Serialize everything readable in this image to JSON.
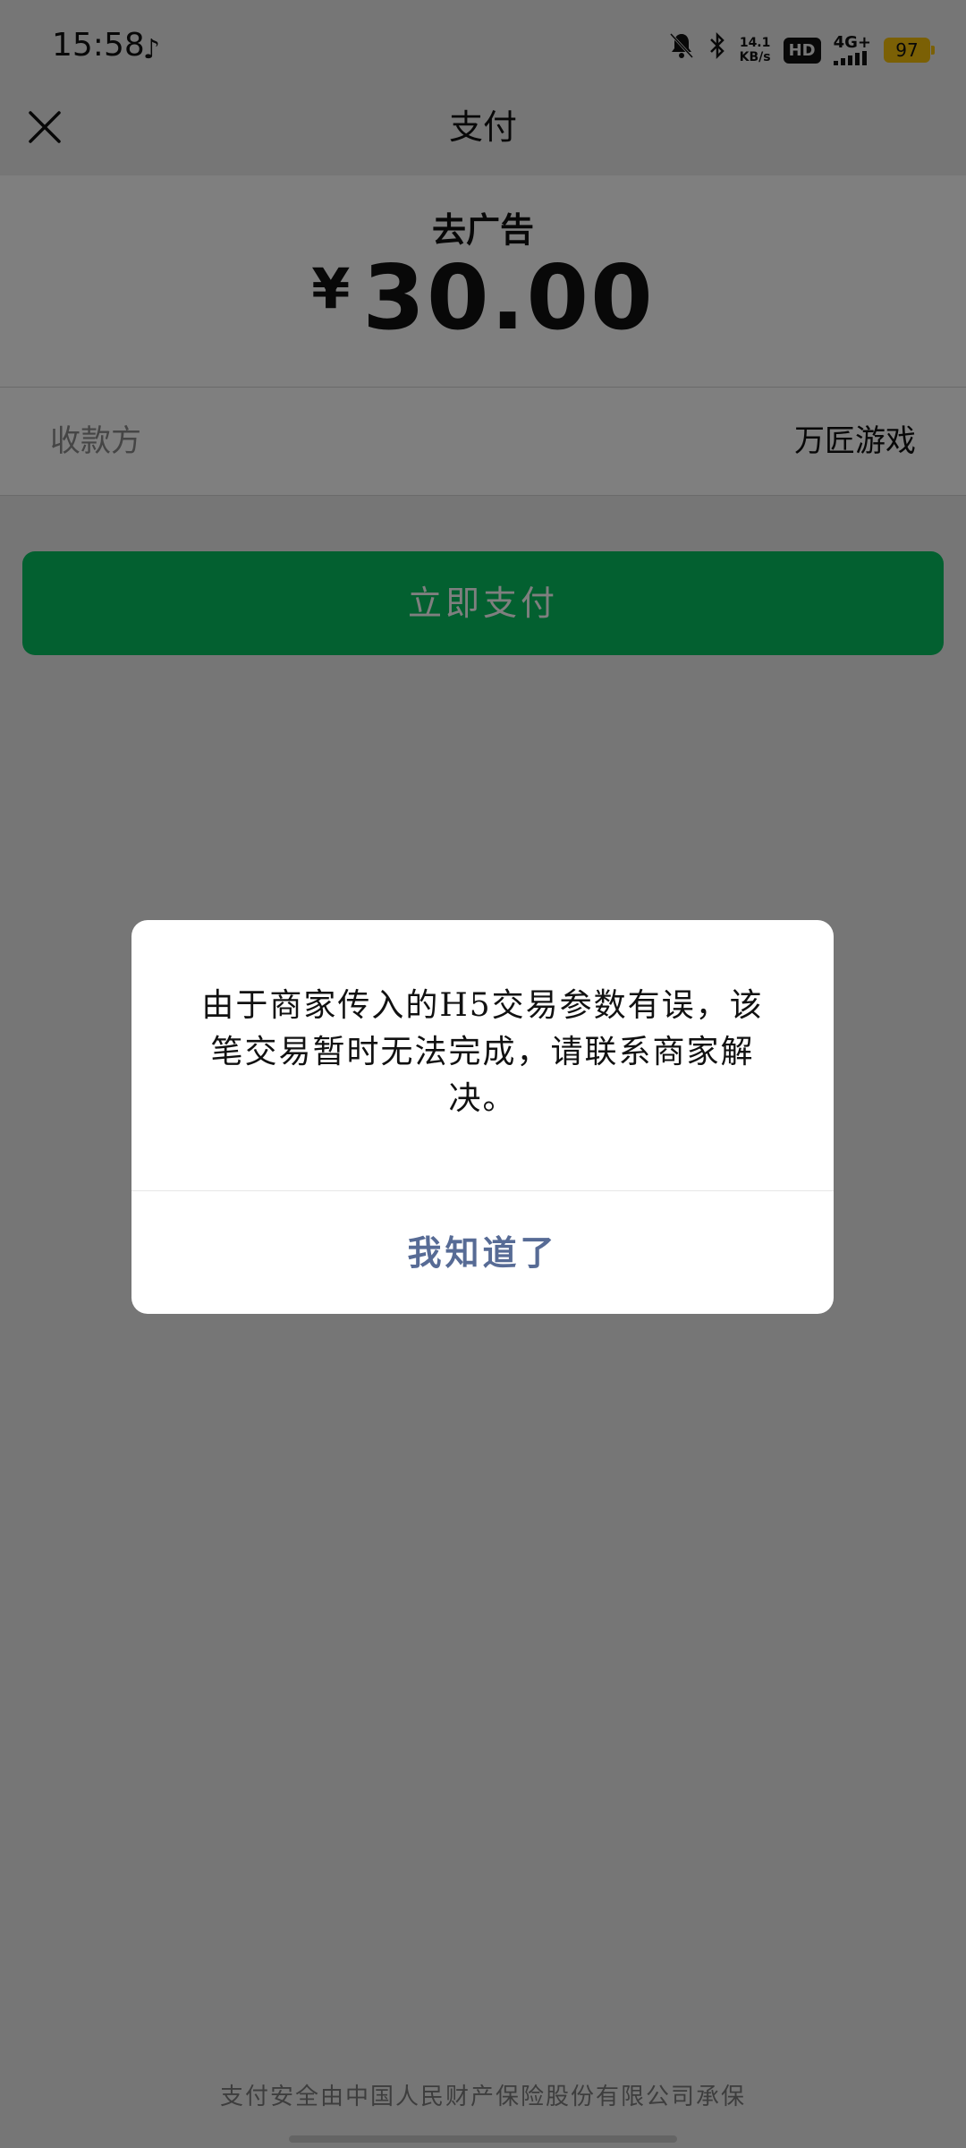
{
  "status_bar": {
    "time": "15:58",
    "net_speed_value": "14.1",
    "net_speed_unit": "KB/s",
    "hd_label": "HD",
    "network": "4G+",
    "battery": "97"
  },
  "header": {
    "title": "支付"
  },
  "payment": {
    "product": "去广告",
    "currency": "¥",
    "amount": "30.00",
    "payee_label": "收款方",
    "payee_value": "万匠游戏",
    "pay_button": "立即支付"
  },
  "footer": {
    "text": "支付安全由中国人民财产保险股份有限公司承保"
  },
  "dialog": {
    "message": "由于商家传入的H5交易参数有误，该笔交易暂时无法完成，请联系商家解决。",
    "button": "我知道了"
  },
  "colors": {
    "primary_green": "#07c160",
    "link_blue": "#576b95",
    "battery_yellow": "#f6c10a"
  }
}
